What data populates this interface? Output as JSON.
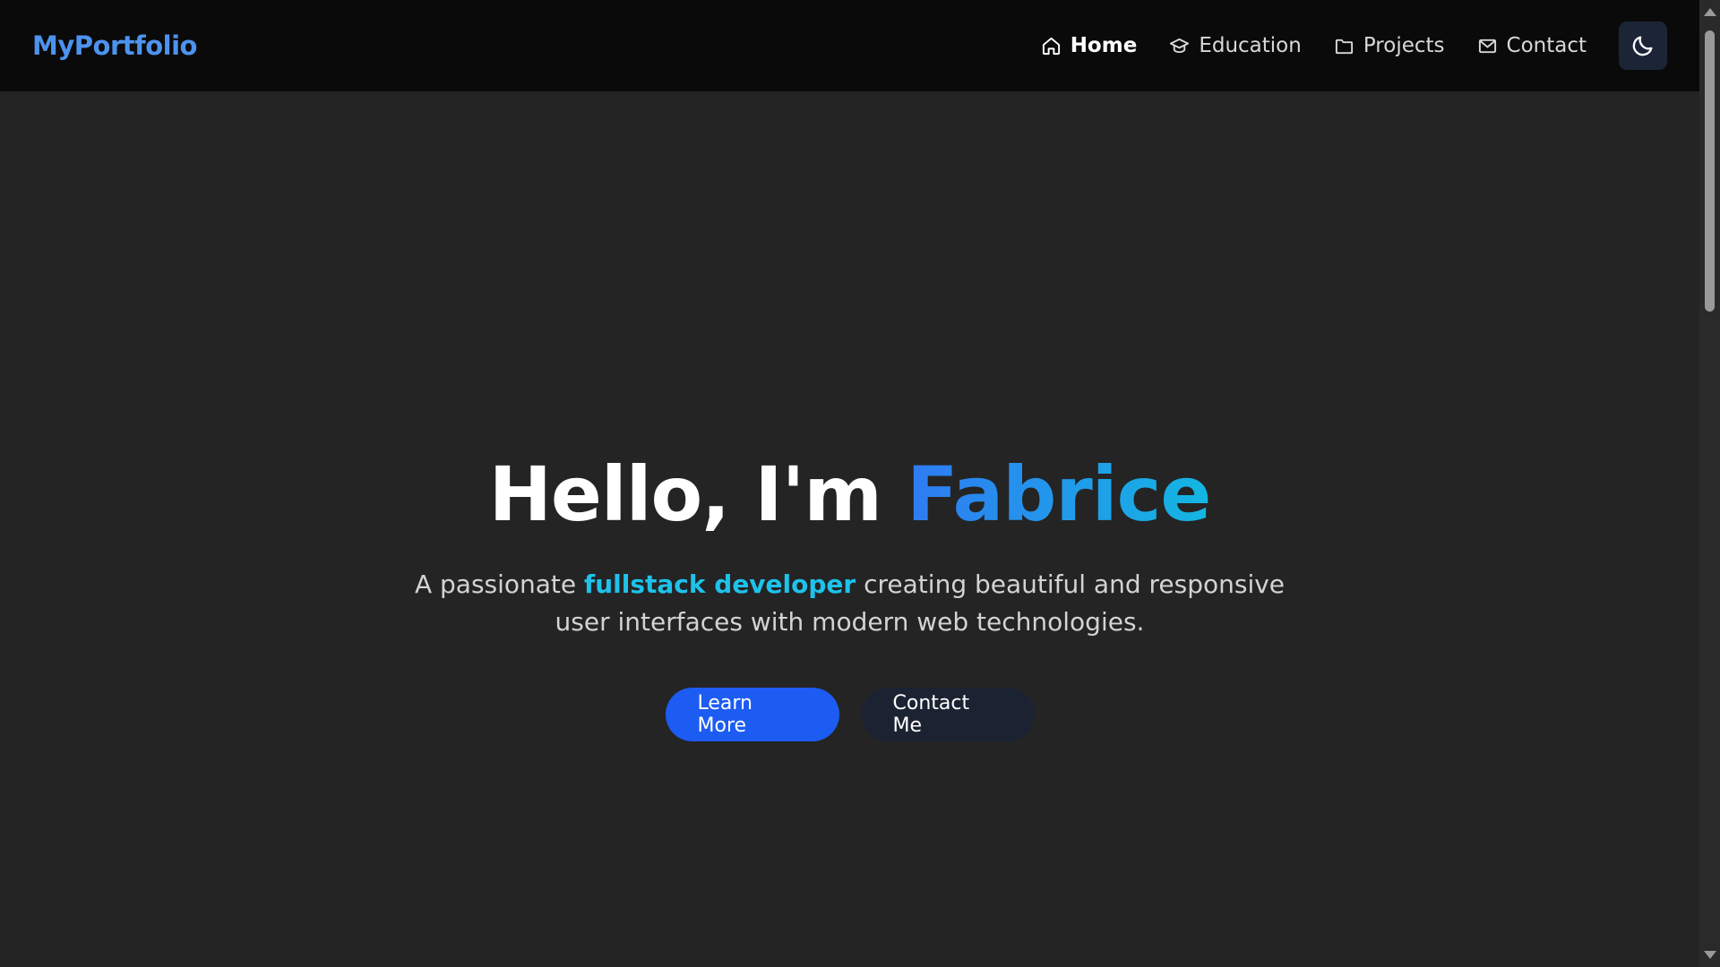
{
  "navbar": {
    "brand": "MyPortfolio",
    "items": [
      {
        "label": "Home",
        "icon": "home-icon",
        "active": true
      },
      {
        "label": "Education",
        "icon": "graduation-cap-icon",
        "active": false
      },
      {
        "label": "Projects",
        "icon": "folder-icon",
        "active": false
      },
      {
        "label": "Contact",
        "icon": "mail-icon",
        "active": false
      }
    ],
    "theme_toggle_icon": "moon-icon"
  },
  "hero": {
    "greeting": "Hello, I'm ",
    "name": "Fabrice",
    "subtitle_prefix": "A passionate ",
    "subtitle_highlight": "fullstack developer",
    "subtitle_suffix": " creating beautiful and responsive user interfaces with modern web technologies.",
    "primary_button": "Learn More",
    "secondary_button": "Contact Me"
  },
  "colors": {
    "background": "#242424",
    "navbar": "#0a0a0a",
    "brand": "#4d93ee",
    "accent_blue": "#1d5cf2",
    "accent_cyan": "#1ec2ea",
    "secondary_button": "#1b2333"
  }
}
